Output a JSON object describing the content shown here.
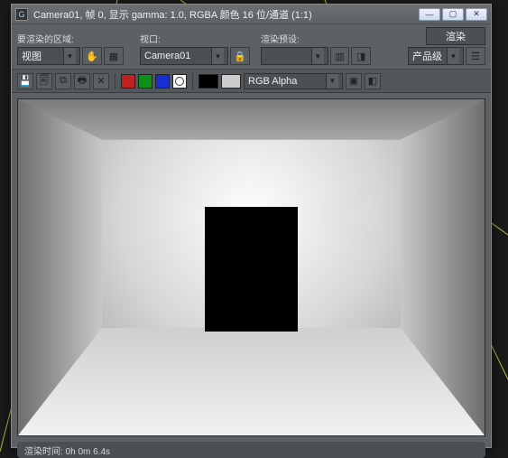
{
  "titlebar": {
    "app_icon_glyph": "G",
    "title": "Camera01, 帧 0, 显示 gamma: 1.0, RGBA 颜色 16 位/通道 (1:1)"
  },
  "controls": {
    "region_label": "要渲染的区域:",
    "region_value": "视图",
    "viewport_label": "视口:",
    "viewport_value": "Camera01",
    "preset_label": "渲染预设:",
    "preset_value": "",
    "output_value": "产品级",
    "render_button": "渲染"
  },
  "toolbar2": {
    "channel_value": "RGB Alpha",
    "swatches": {
      "a": "#c02020",
      "b": "#109018",
      "c": "#1830d0"
    },
    "sample_fill": "#000000",
    "sample_checker": "#cccccc"
  },
  "status": {
    "text": "渲染时间: 0h 0m 6.4s"
  }
}
